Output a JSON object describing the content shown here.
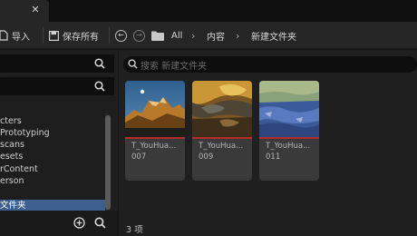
{
  "toolbar": {
    "import_label": "导入",
    "save_all_label": "保存所有",
    "breadcrumbs": [
      "All",
      "内容",
      "新建文件夹"
    ]
  },
  "left_panel": {
    "tree": [
      "cters",
      "Prototyping",
      "scans",
      "esets",
      "rContent",
      "erson",
      "文件夹"
    ]
  },
  "assets": {
    "search_placeholder": "搜索 新建文件夹",
    "items": [
      {
        "title": "T_YouHua...",
        "sub": "007"
      },
      {
        "title": "T_YouHua...",
        "sub": "009"
      },
      {
        "title": "T_YouHua...",
        "sub": "011"
      }
    ],
    "count_label": "3 项"
  },
  "colors": {
    "selection": "#3d5f8f",
    "asset_type_line": "#b52a2a",
    "panel_bg": "#1f1f1f"
  }
}
